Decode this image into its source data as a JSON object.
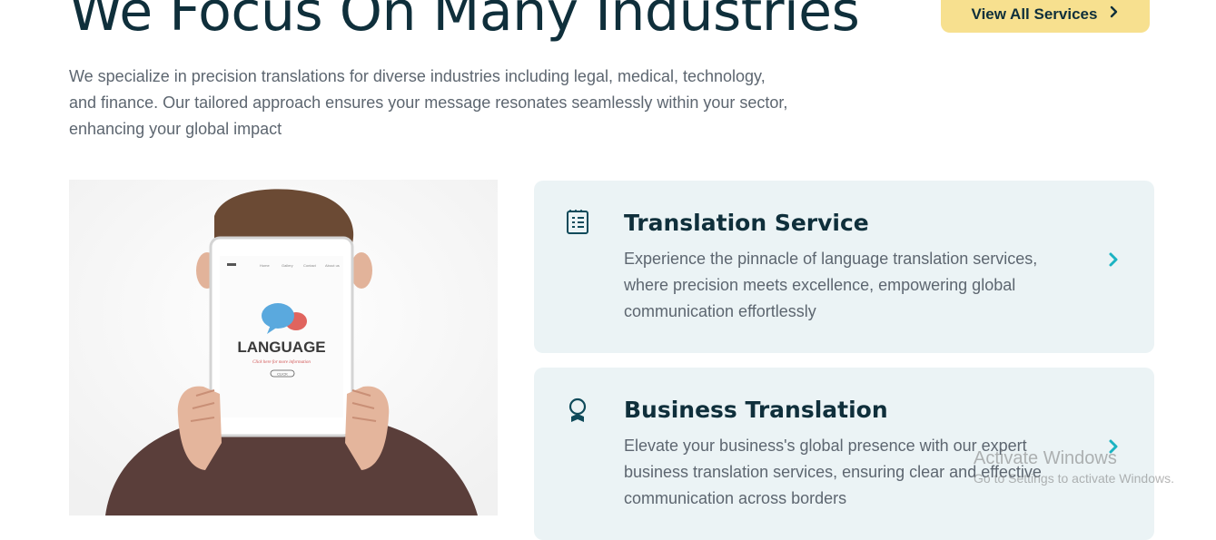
{
  "section": {
    "title": "We Focus On Many Industries",
    "intro": "We specialize in precision translations for diverse industries including legal, medical, technology, and finance. Our tailored approach ensures your message resonates seamlessly within your sector, enhancing your global impact",
    "view_all_label": "View All Services"
  },
  "photo": {
    "tablet_heading": "LANGUAGE",
    "tablet_subtext": "Click here for more information",
    "tablet_nav": [
      "Home",
      "Gallery",
      "Contact",
      "About us"
    ],
    "tablet_button": "CLICK"
  },
  "services": [
    {
      "title": "Translation Service",
      "description": "Experience the pinnacle of language translation services, where precision meets excellence, empowering global communication effortlessly",
      "icon": "document-list-icon"
    },
    {
      "title": "Business Translation",
      "description": "Elevate your business's global presence with our expert business translation services, ensuring clear and effective communication across borders",
      "icon": "award-ribbon-icon"
    }
  ],
  "watermark": {
    "line1": "Activate Windows",
    "line2": "Go to Settings to activate Windows."
  },
  "colors": {
    "heading": "#0f2f3b",
    "body_text": "#5d6670",
    "button_bg": "#f7e08f",
    "card_bg": "#ebf3f5",
    "accent_teal": "#1bb3c2"
  }
}
